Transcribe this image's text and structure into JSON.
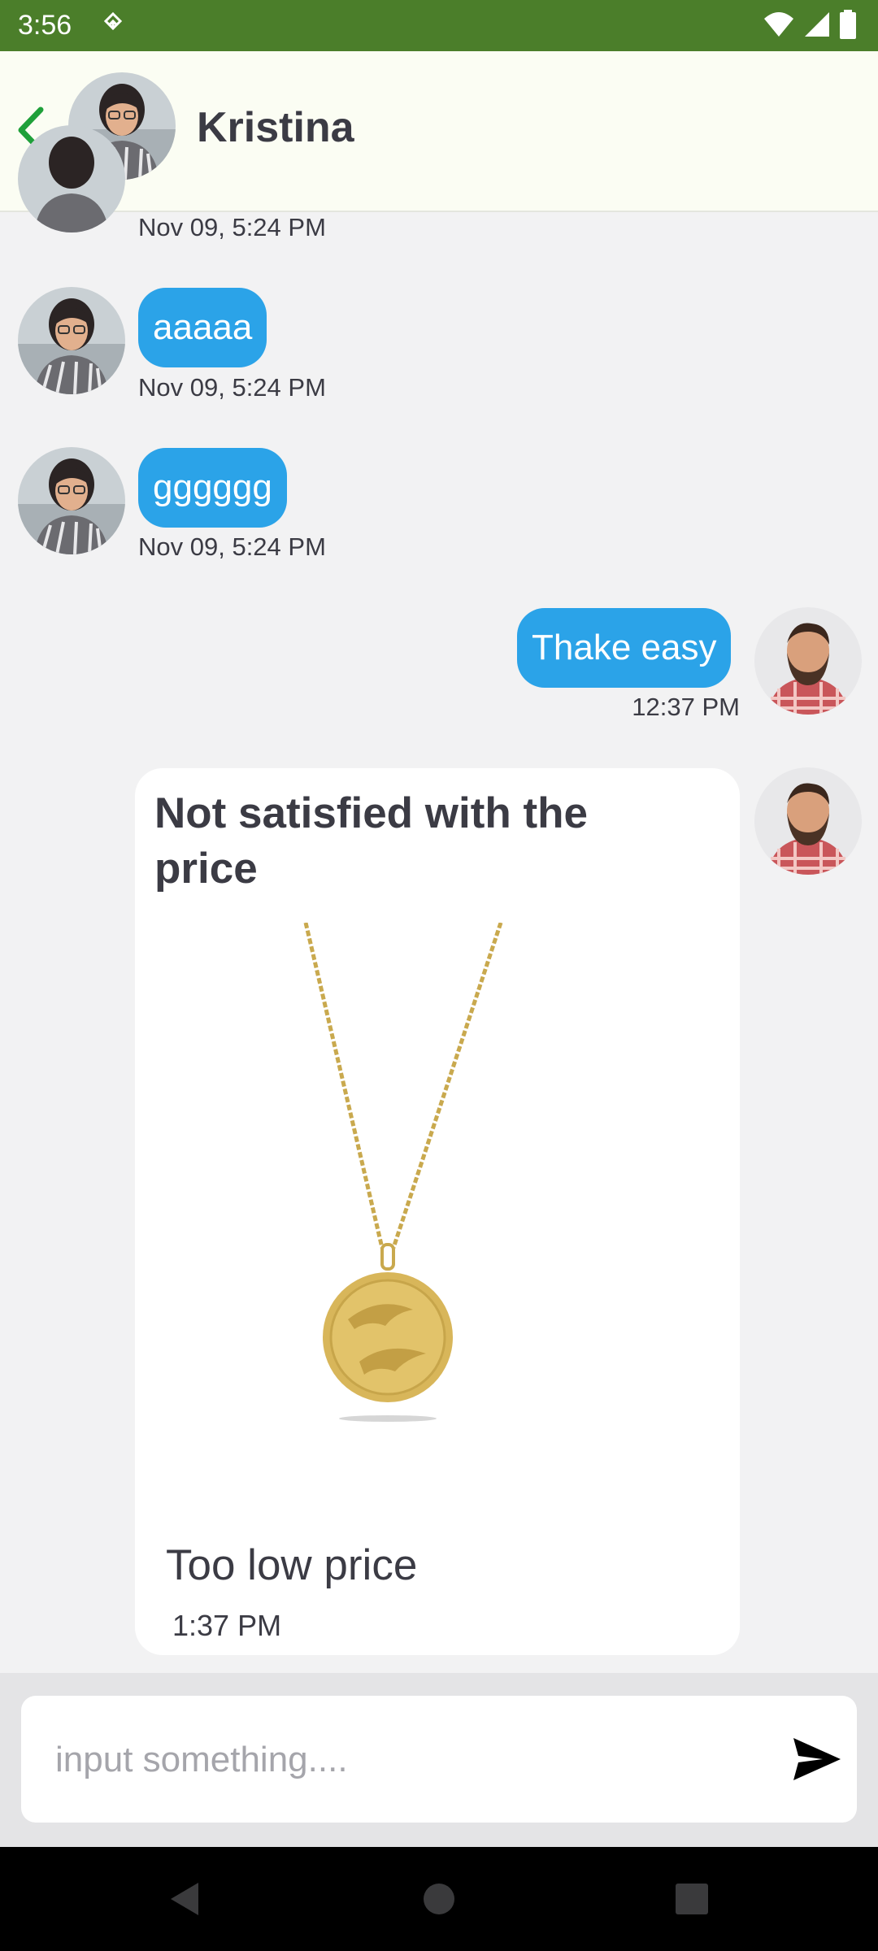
{
  "status_bar": {
    "time": "3:56",
    "icons": [
      "navigation-icon",
      "wifi-icon",
      "signal-icon",
      "battery-icon"
    ]
  },
  "header": {
    "back_icon": "chevron-left-icon",
    "contact_name": "Kristina",
    "accent_color": "#1fa03a"
  },
  "messages": [
    {
      "sender": "contact",
      "text": "",
      "time": "Nov 09, 5:24 PM"
    },
    {
      "sender": "contact",
      "text": "aaaaa",
      "time": "Nov 09, 5:24 PM"
    },
    {
      "sender": "contact",
      "text": "gggggg",
      "time": "Nov 09, 5:24 PM"
    },
    {
      "sender": "me",
      "text": "Thake easy",
      "time": "12:37 PM"
    }
  ],
  "card": {
    "title": "Not satisfied with the price",
    "image": "gold-coin-pendant-necklace",
    "note": "Too low price",
    "time": "1:37 PM"
  },
  "composer": {
    "placeholder": "input something....",
    "send_icon": "send-icon"
  },
  "colors": {
    "status_bar": "#4b7e2a",
    "header_bg": "#fbfdf3",
    "bubble": "#2ba3e8",
    "chat_bg": "#f2f2f3"
  }
}
